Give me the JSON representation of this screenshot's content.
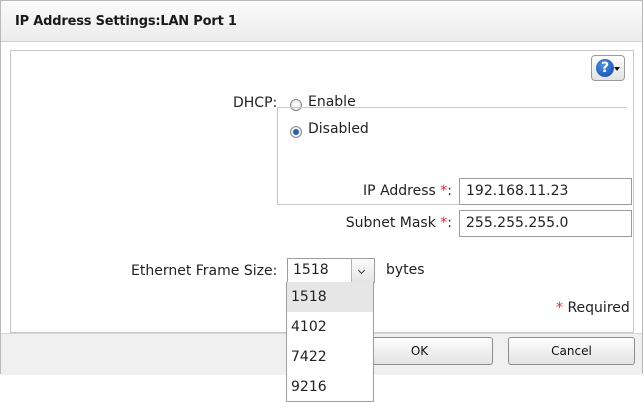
{
  "dialog": {
    "title": "IP Address Settings:LAN Port 1"
  },
  "help": {
    "glyph": "?"
  },
  "dhcp": {
    "label": "DHCP:",
    "options": [
      {
        "label": "Enable",
        "selected": false
      },
      {
        "label": "Disabled",
        "selected": true
      }
    ]
  },
  "ip_address": {
    "label": "IP Address",
    "required_mark": "*",
    "colon": ":",
    "value": "192.168.11.23"
  },
  "subnet_mask": {
    "label": "Subnet Mask",
    "required_mark": "*",
    "colon": ":",
    "value": "255.255.255.0"
  },
  "frame_size": {
    "label": "Ethernet Frame Size:",
    "selected": "1518",
    "unit": "bytes",
    "options": [
      "1518",
      "4102",
      "7422",
      "9216"
    ]
  },
  "required_note": {
    "mark": "*",
    "text": "Required"
  },
  "buttons": {
    "ok": "OK",
    "cancel": "Cancel"
  },
  "colors": {
    "accent": "#0b4aa8",
    "required": "#e0292a",
    "selected_option": "#e6e6e6"
  }
}
